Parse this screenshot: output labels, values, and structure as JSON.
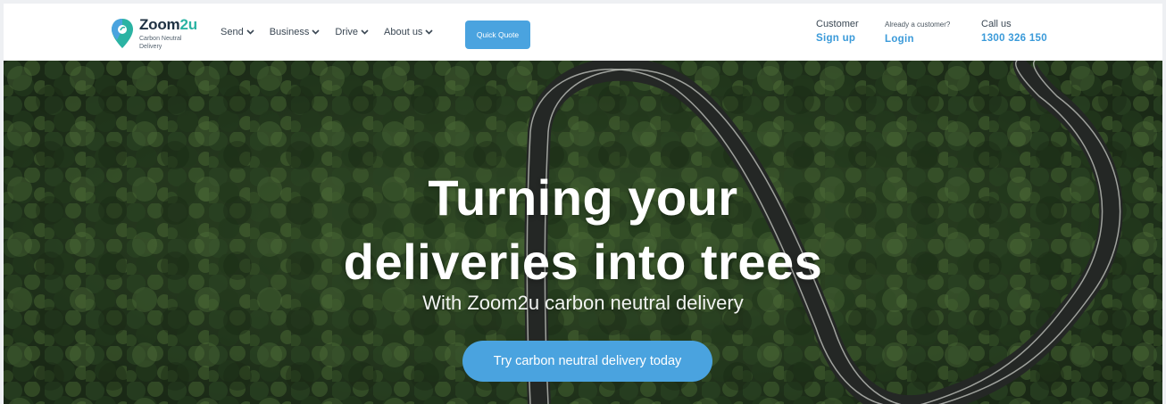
{
  "brand": {
    "name_part1": "Zoom",
    "name_part2": "2u",
    "tagline": "Carbon Neutral Delivery",
    "primary_color": "#4aa3df",
    "accent_color": "#2bb3a3"
  },
  "nav": {
    "items": [
      {
        "label": "Send",
        "icon": "chevron-down-icon"
      },
      {
        "label": "Business",
        "icon": "chevron-down-icon"
      },
      {
        "label": "Drive",
        "icon": "chevron-down-icon"
      },
      {
        "label": "About us",
        "icon": "chevron-down-icon"
      }
    ],
    "quote_button": "Quick Quote"
  },
  "header_right": {
    "customer_label": "Customer",
    "signup_link": "Sign up",
    "already_label": "Already a customer?",
    "login_link": "Login",
    "call_label": "Call us",
    "phone": "1300 326 150"
  },
  "hero": {
    "title_line1": "Turning your",
    "title_line2": "deliveries into trees",
    "subtitle": "With Zoom2u carbon neutral delivery",
    "cta_label": "Try carbon neutral delivery today",
    "background": "forest-aerial-road-image"
  }
}
